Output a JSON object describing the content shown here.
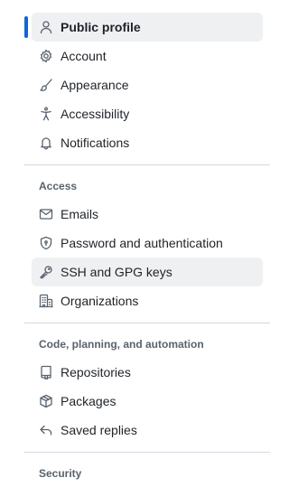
{
  "nav": {
    "group1": [
      {
        "label": "Public profile",
        "icon": "person-icon",
        "active": true
      },
      {
        "label": "Account",
        "icon": "gear-icon"
      },
      {
        "label": "Appearance",
        "icon": "paintbrush-icon"
      },
      {
        "label": "Accessibility",
        "icon": "accessibility-icon"
      },
      {
        "label": "Notifications",
        "icon": "bell-icon"
      }
    ],
    "access": {
      "heading": "Access",
      "items": [
        {
          "label": "Emails",
          "icon": "mail-icon"
        },
        {
          "label": "Password and authentication",
          "icon": "shield-lock-icon"
        },
        {
          "label": "SSH and GPG keys",
          "icon": "key-icon",
          "hovered": true
        },
        {
          "label": "Organizations",
          "icon": "organization-icon"
        }
      ]
    },
    "automation": {
      "heading": "Code, planning, and automation",
      "items": [
        {
          "label": "Repositories",
          "icon": "repo-icon"
        },
        {
          "label": "Packages",
          "icon": "package-icon"
        },
        {
          "label": "Saved replies",
          "icon": "reply-icon"
        }
      ]
    },
    "security": {
      "heading": "Security"
    }
  },
  "colors": {
    "accent": "#0969da",
    "active_bg": "#eef0f2",
    "text": "#1f2328",
    "muted": "#59636e",
    "divider": "#d1d9e0"
  }
}
